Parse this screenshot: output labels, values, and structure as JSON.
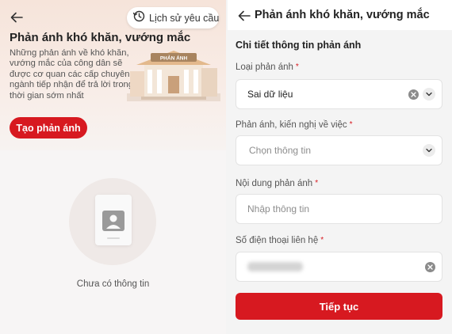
{
  "left": {
    "history_label": "Lịch sử yêu cầu",
    "title": "Phản ánh khó khăn, vướng mắc",
    "description": "Những phản ánh về khó khăn, vướng mắc của công dân sẽ được cơ quan các cấp chuyên ngành tiếp nhận để trả lời trong thời gian sớm nhất",
    "building_sign": "PHẢN ÁNH",
    "create_button": "Tạo phản ánh",
    "empty_text": "Chưa có thông tin"
  },
  "right": {
    "header_title": "Phản ánh khó khăn, vướng mắc",
    "section_title": "Chi tiết thông tin phản ánh",
    "fields": [
      {
        "label": "Loại phản ánh",
        "required": "*",
        "value": "Sai dữ liệu"
      },
      {
        "label": "Phản ánh, kiến nghị về việc",
        "required": "*",
        "placeholder": "Chọn thông tin"
      },
      {
        "label": "Nội dung phản ánh",
        "required": "*",
        "placeholder": "Nhập thông tin"
      },
      {
        "label": "Số điện thoại liên hệ",
        "required": "*"
      }
    ],
    "submit_button": "Tiếp tục"
  },
  "colors": {
    "brand_red": "#d71920",
    "hero_bg": "#f6e4da",
    "page_bg": "#f4f4f4"
  },
  "icons": [
    "back-arrow-icon",
    "history-clock-icon",
    "building-illustration",
    "person-card-icon",
    "clear-icon",
    "chevron-down-icon"
  ]
}
